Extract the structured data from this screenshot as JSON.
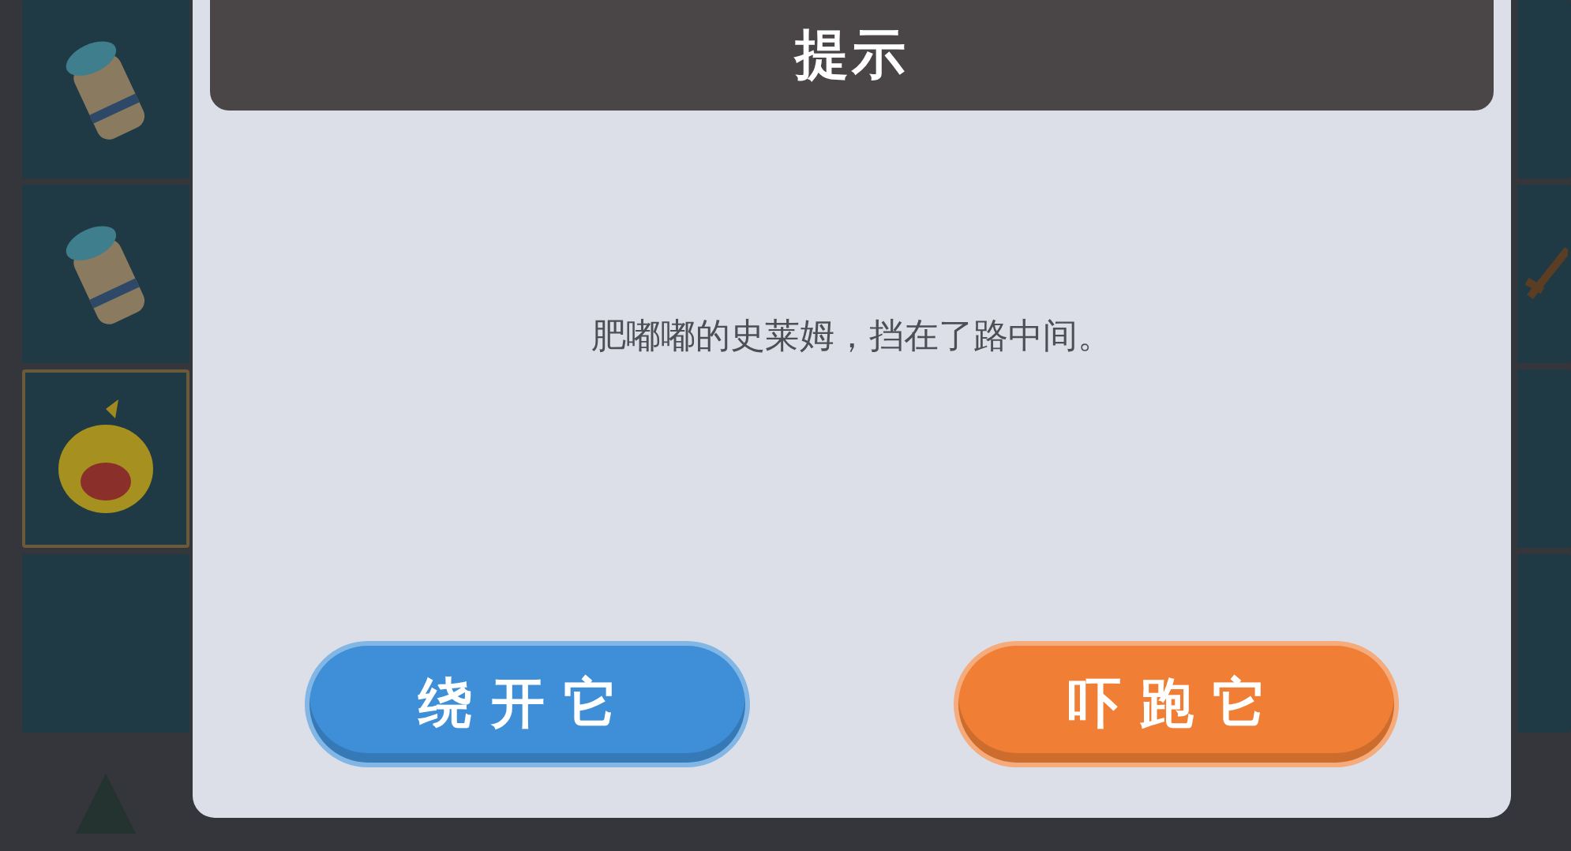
{
  "dialog": {
    "title": "提示",
    "message": "肥嘟嘟的史莱姆，挡在了路中间。",
    "buttons": [
      {
        "label": "绕开它",
        "color": "#3f8fd8"
      },
      {
        "label": "吓跑它",
        "color": "#f07f35"
      }
    ]
  }
}
